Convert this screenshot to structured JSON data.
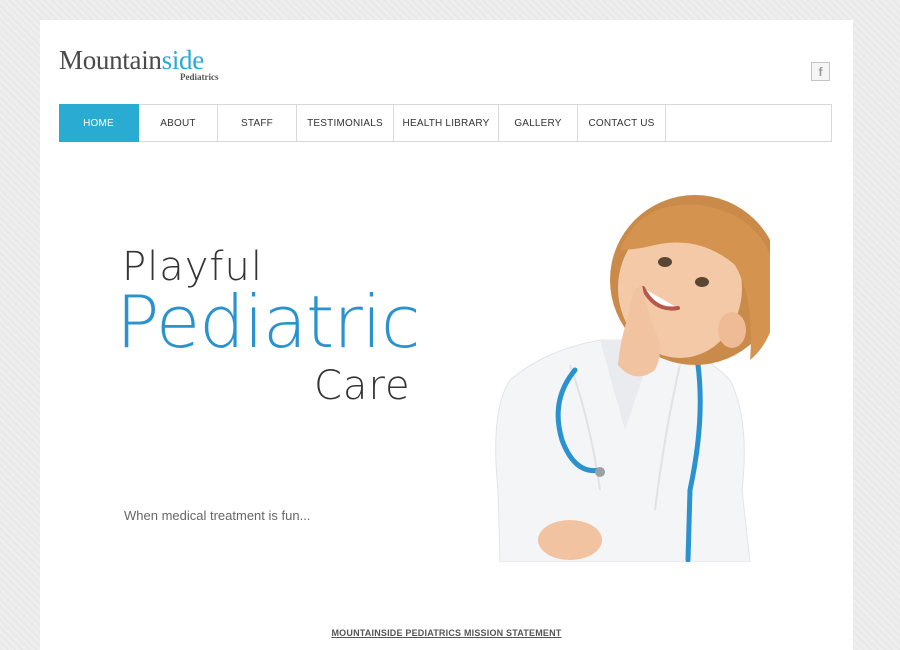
{
  "logo": {
    "main_prefix": "Mountain",
    "main_accent": "side",
    "sub": "Pediatrics"
  },
  "social": {
    "facebook_glyph": "f",
    "icon": "facebook-icon"
  },
  "nav": {
    "items": [
      {
        "label": "HOME",
        "active": true
      },
      {
        "label": "ABOUT"
      },
      {
        "label": "STAFF"
      },
      {
        "label": "TESTIMONIALS"
      },
      {
        "label": "HEALTH LIBRARY"
      },
      {
        "label": "GALLERY"
      },
      {
        "label": "CONTACT US"
      }
    ]
  },
  "hero": {
    "line1": "Playful",
    "line2": "Pediatric",
    "line3": "Care",
    "tagline": "When medical treatment is fun..."
  },
  "mission_link": "MOUNTAINSIDE PEDIATRICS MISSION STATEMENT",
  "colors": {
    "accent": "#2aabd2",
    "headline_blue": "#2a93cf",
    "text_dark": "#333333"
  }
}
